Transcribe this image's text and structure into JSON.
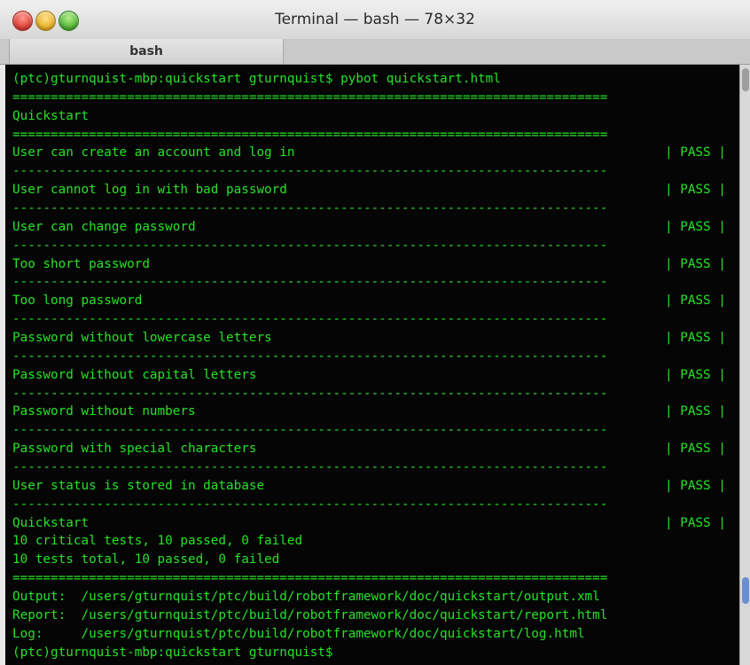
{
  "window": {
    "title": "Terminal — bash — 78×32",
    "tab": "bash"
  },
  "terminal": {
    "prompt_cmd": "(ptc)gturnquist-mbp:quickstart gturnquist$ pybot quickstart.html",
    "double_rule": "==============================================================================",
    "single_rule": "------------------------------------------------------------------------------",
    "suite_name": "Quickstart",
    "tests": [
      {
        "name": "User can create an account and log in",
        "status": "| PASS |"
      },
      {
        "name": "User cannot log in with bad password",
        "status": "| PASS |"
      },
      {
        "name": "User can change password",
        "status": "| PASS |"
      },
      {
        "name": "Too short password",
        "status": "| PASS |"
      },
      {
        "name": "Too long password",
        "status": "| PASS |"
      },
      {
        "name": "Password without lowercase letters",
        "status": "| PASS |"
      },
      {
        "name": "Password without capital letters",
        "status": "| PASS |"
      },
      {
        "name": "Password without numbers",
        "status": "| PASS |"
      },
      {
        "name": "Password with special characters",
        "status": "| PASS |"
      },
      {
        "name": "User status is stored in database",
        "status": "| PASS |"
      }
    ],
    "suite_result": {
      "name": "Quickstart",
      "status": "| PASS |"
    },
    "summary1": "10 critical tests, 10 passed, 0 failed",
    "summary2": "10 tests total, 10 passed, 0 failed",
    "output": "Output:  /users/gturnquist/ptc/build/robotframework/doc/quickstart/output.xml",
    "report": "Report:  /users/gturnquist/ptc/build/robotframework/doc/quickstart/report.html",
    "log": "Log:     /users/gturnquist/ptc/build/robotframework/doc/quickstart/log.html",
    "final_prompt": "(ptc)gturnquist-mbp:quickstart gturnquist$"
  }
}
